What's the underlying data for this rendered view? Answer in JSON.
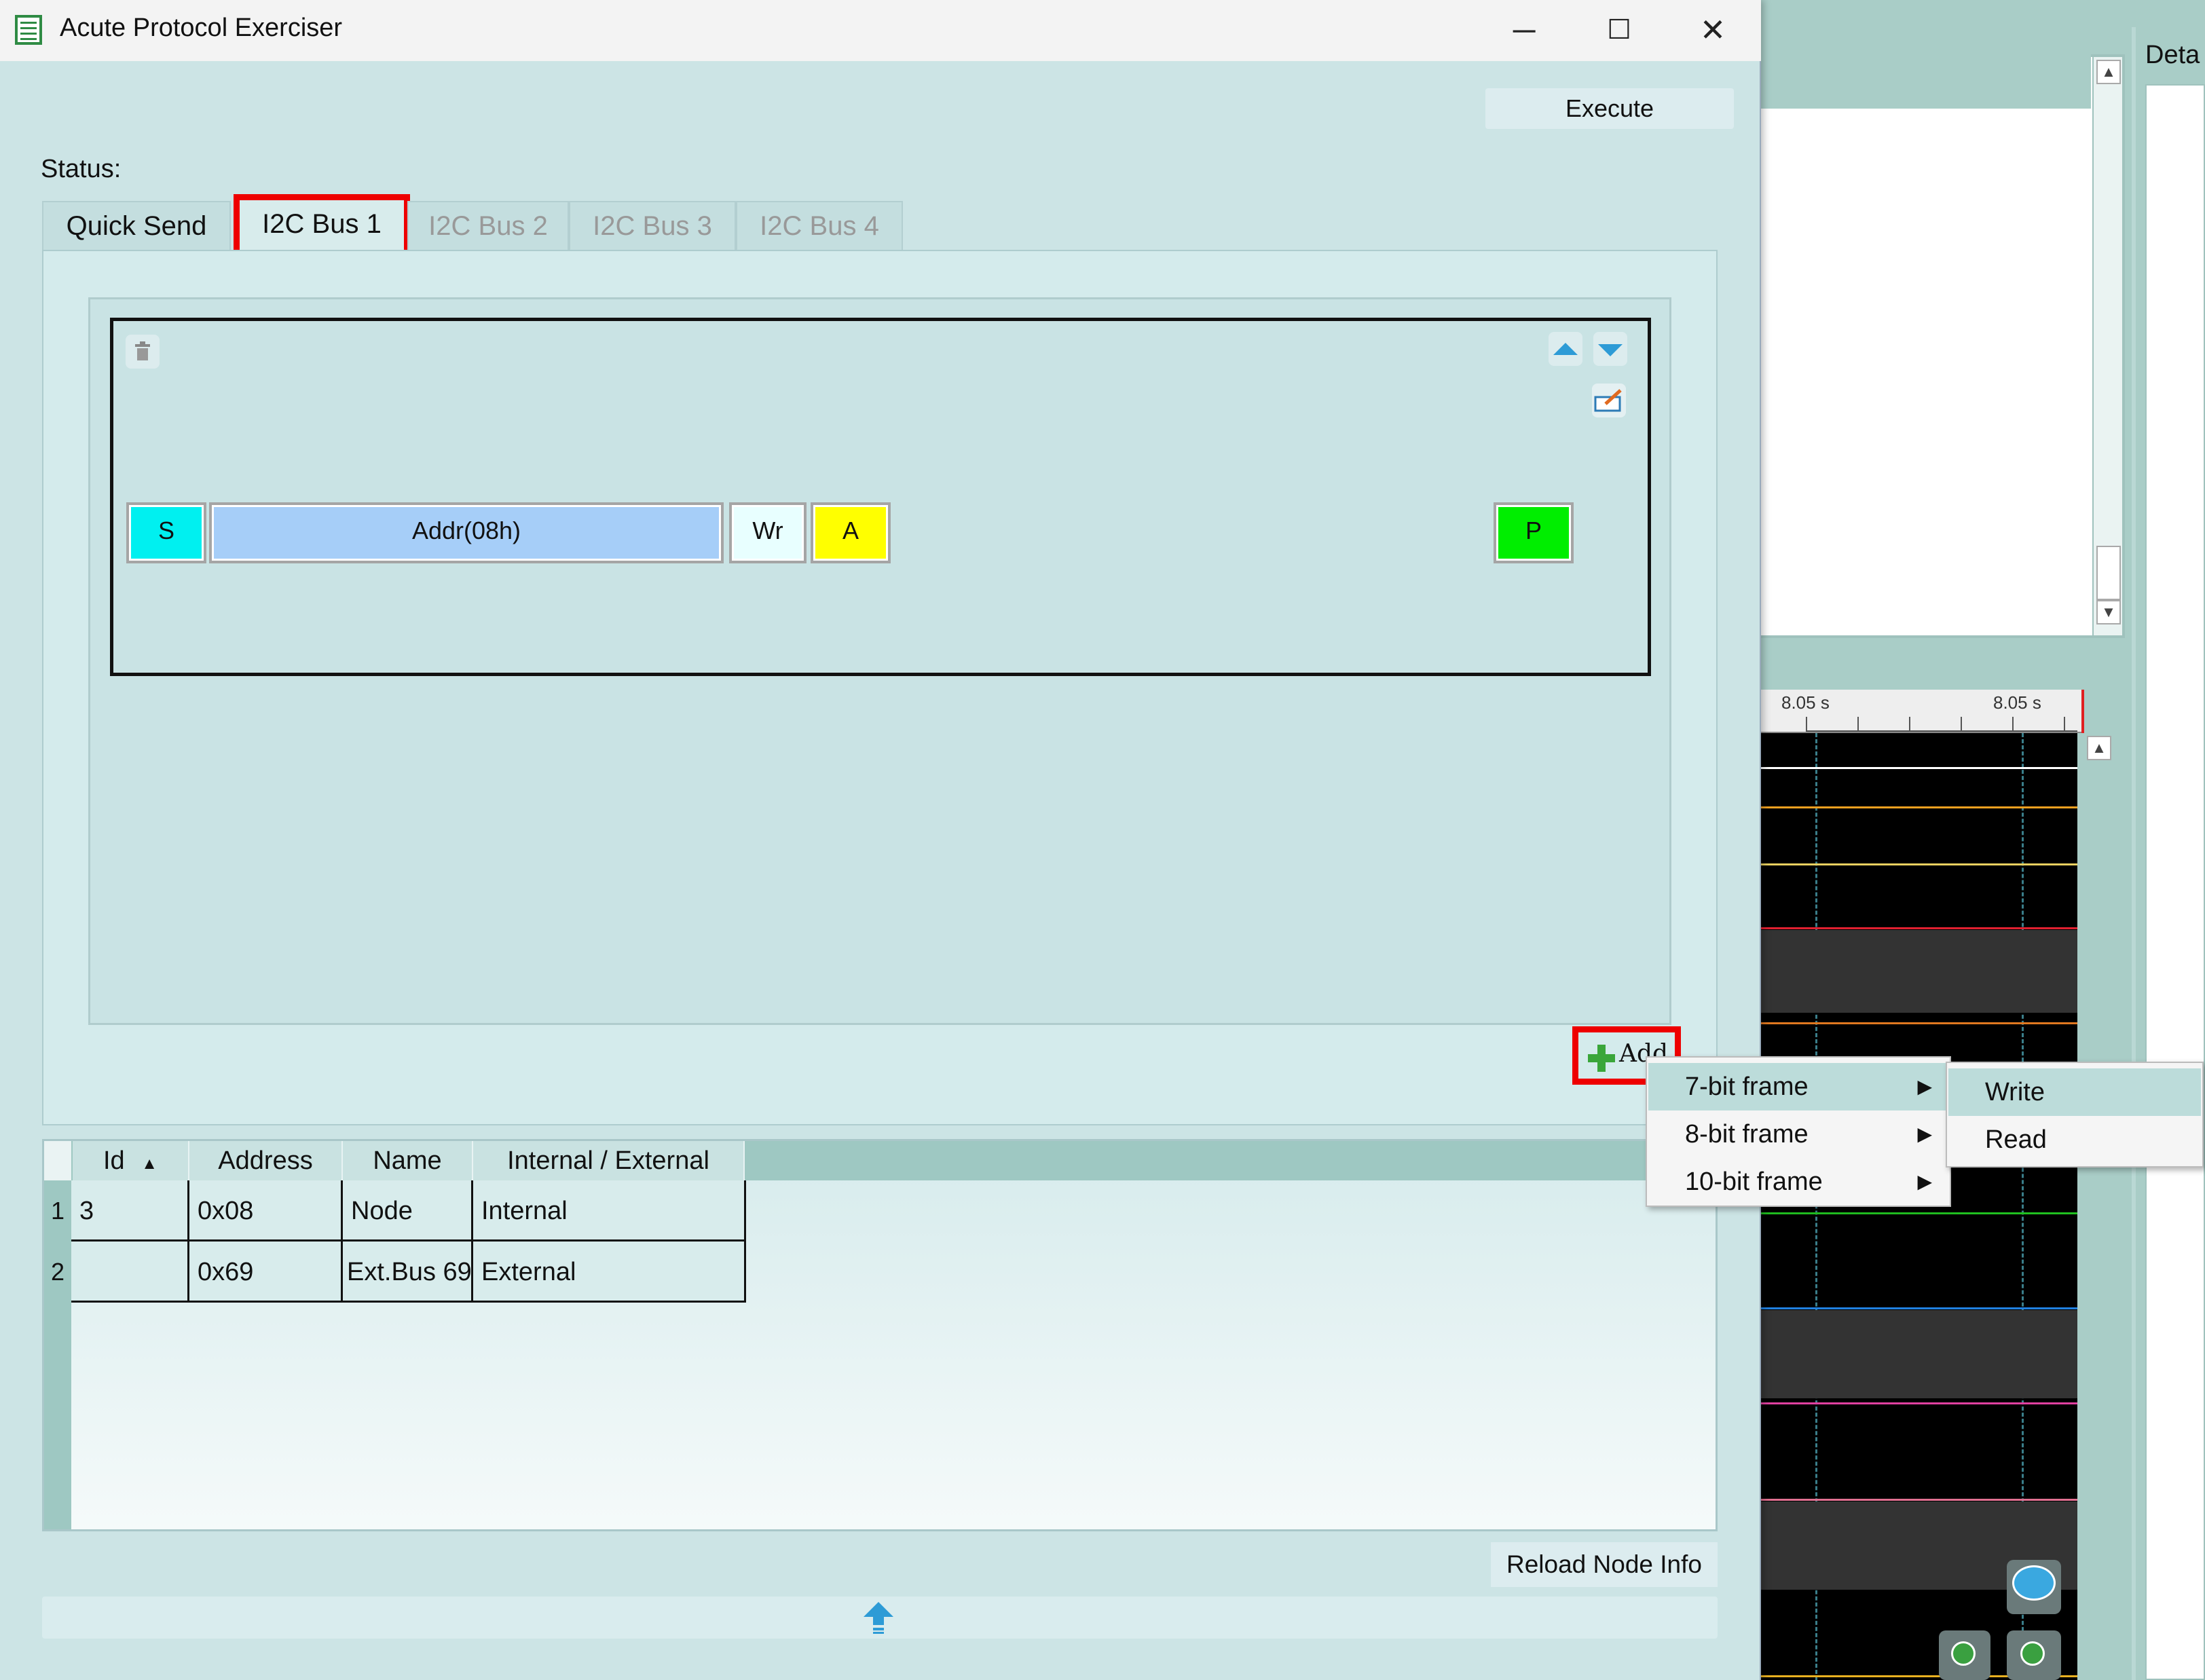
{
  "window": {
    "title": "Acute Protocol Exerciser",
    "minimize_glyph": "─",
    "maximize_glyph": "☐",
    "close_glyph": "✕"
  },
  "toolbar": {
    "execute_label": "Execute"
  },
  "status": {
    "label": "Status:"
  },
  "tabs": [
    {
      "label": "Quick Send",
      "state": "normal"
    },
    {
      "label": "I2C Bus 1",
      "state": "active"
    },
    {
      "label": "I2C Bus 2",
      "state": "inactive"
    },
    {
      "label": "I2C Bus 3",
      "state": "inactive"
    },
    {
      "label": "I2C Bus 4",
      "state": "inactive"
    }
  ],
  "frame": {
    "segments": [
      {
        "label": "S",
        "color": "#00f0f0"
      },
      {
        "label": "Addr(08h)",
        "color": "#a6cef8"
      },
      {
        "label": "Wr",
        "color": "#e8ffff"
      },
      {
        "label": "A",
        "color": "#ffff00"
      },
      {
        "label": "P",
        "color": "#00ee00"
      }
    ]
  },
  "add_button": {
    "label": "Add"
  },
  "context_menu": {
    "items": [
      {
        "label": "7-bit frame",
        "highlighted": true
      },
      {
        "label": "8-bit frame",
        "highlighted": false
      },
      {
        "label": "10-bit frame",
        "highlighted": false
      }
    ],
    "submenu": [
      {
        "label": "Write",
        "highlighted": true
      },
      {
        "label": "Read",
        "highlighted": false
      }
    ]
  },
  "node_table": {
    "columns": [
      "Id",
      "Address",
      "Name",
      "Internal / External"
    ],
    "sort_indicator": "▲",
    "rows": [
      {
        "num": "1",
        "id": "3",
        "address": "0x08",
        "name": "Node",
        "type": "Internal"
      },
      {
        "num": "2",
        "id": "",
        "address": "0x69",
        "name": "Ext.Bus 69",
        "type": "External"
      }
    ]
  },
  "reload_button": {
    "label": "Reload Node Info"
  },
  "background_app": {
    "detail_header": "Deta",
    "ruler_ticks": [
      "8.05 s",
      "8.05 s"
    ],
    "trace_colors": [
      "#f0a020",
      "#e8d060",
      "#e02030",
      "#e07820",
      "#20c020",
      "#2080e0",
      "#e040a0",
      "#e07090",
      "#e8b020"
    ]
  },
  "colors": {
    "highlight_red": "#ee0000",
    "window_bg": "#cce4e5",
    "accent_blue": "#2d9bd6"
  }
}
